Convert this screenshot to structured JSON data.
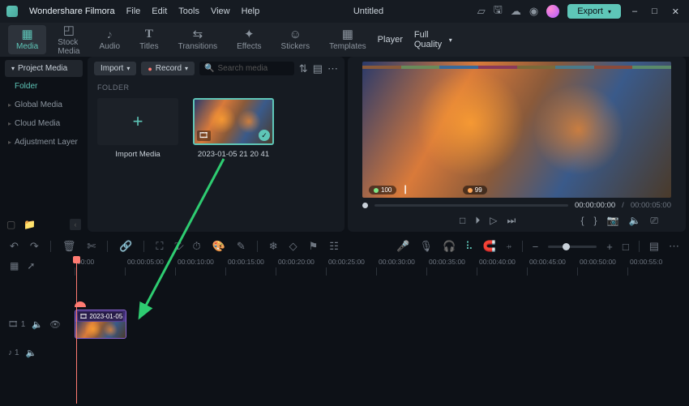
{
  "app": {
    "name": "Wondershare Filmora",
    "title": "Untitled"
  },
  "menu": [
    "File",
    "Edit",
    "Tools",
    "View",
    "Help"
  ],
  "export_label": "Export",
  "ribbon_tabs": [
    {
      "label": "Media",
      "icon": "▦"
    },
    {
      "label": "Stock Media",
      "icon": "⊞"
    },
    {
      "label": "Audio",
      "icon": "♪"
    },
    {
      "label": "Titles",
      "icon": "T"
    },
    {
      "label": "Transitions",
      "icon": "⇄"
    },
    {
      "label": "Effects",
      "icon": "✦"
    },
    {
      "label": "Stickers",
      "icon": "☺"
    },
    {
      "label": "Templates",
      "icon": "⊞"
    }
  ],
  "player": {
    "label": "Player",
    "quality": "Full Quality"
  },
  "sidebar": {
    "header": "Project Media",
    "folder": "Folder",
    "items": [
      "Global Media",
      "Cloud Media",
      "Adjustment Layer"
    ]
  },
  "browser": {
    "import_label": "Import",
    "record_label": "Record",
    "search_placeholder": "Search media",
    "folder_header": "FOLDER",
    "import_thumb_label": "Import Media",
    "clip_name": "2023-01-05 21 20 41"
  },
  "preview": {
    "hud": {
      "left": "100",
      "right": "99"
    },
    "current_time": "00:00:00:00",
    "duration": "00:00:05:00"
  },
  "ruler_ticks": [
    "00:00",
    "00:00:05:00",
    "00:00:10:00",
    "00:00:15:00",
    "00:00:20:00",
    "00:00:25:00",
    "00:00:30:00",
    "00:00:35:00",
    "00:00:40:00",
    "00:00:45:00",
    "00:00:50:00",
    "00:00:55:0"
  ],
  "tracks": {
    "video": {
      "label": "1",
      "clip_label": "2023-01-05..."
    },
    "audio": {
      "label": "1"
    }
  }
}
